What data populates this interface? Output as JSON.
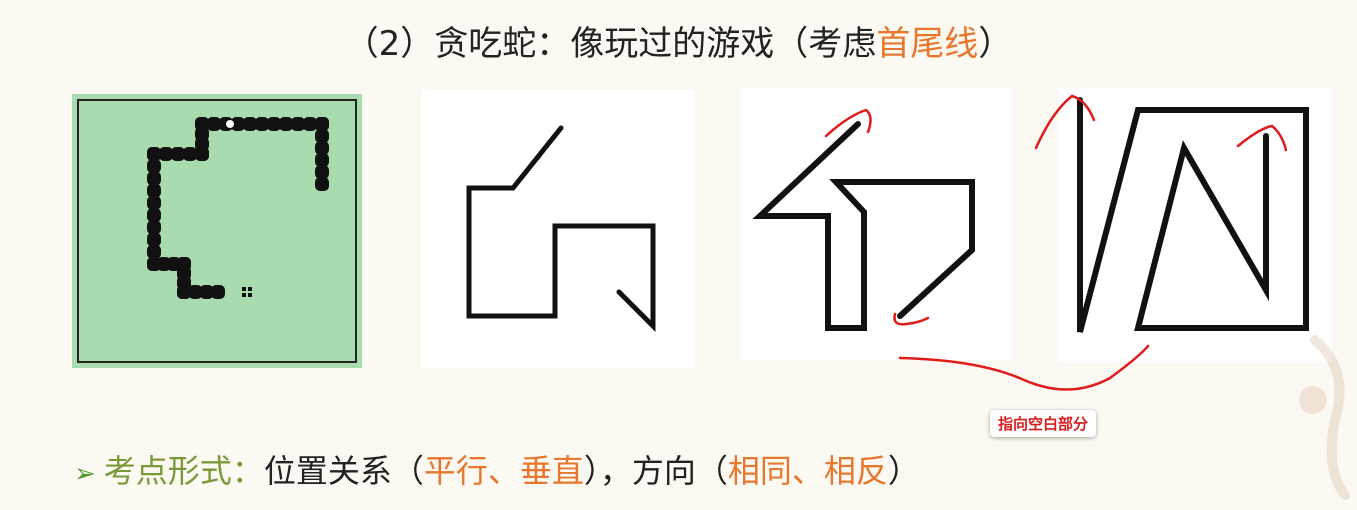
{
  "title": {
    "prefix": "（2）贪吃蛇：像玩过的游戏（考虑",
    "highlight": "首尾线",
    "suffix": "）"
  },
  "callout": "指向空白部分",
  "bullet": {
    "marker": "➢",
    "label": "考点形式：",
    "text1": "位置关系（",
    "highlight1": "平行、垂直",
    "text2": "），方向（",
    "highlight2": "相同、相反",
    "text3": "）"
  },
  "colors": {
    "accent": "#e8772e",
    "bullet_green": "#7a9a3a",
    "annotation_red": "#d81e1e",
    "snake_bg": "#a8dcae"
  }
}
